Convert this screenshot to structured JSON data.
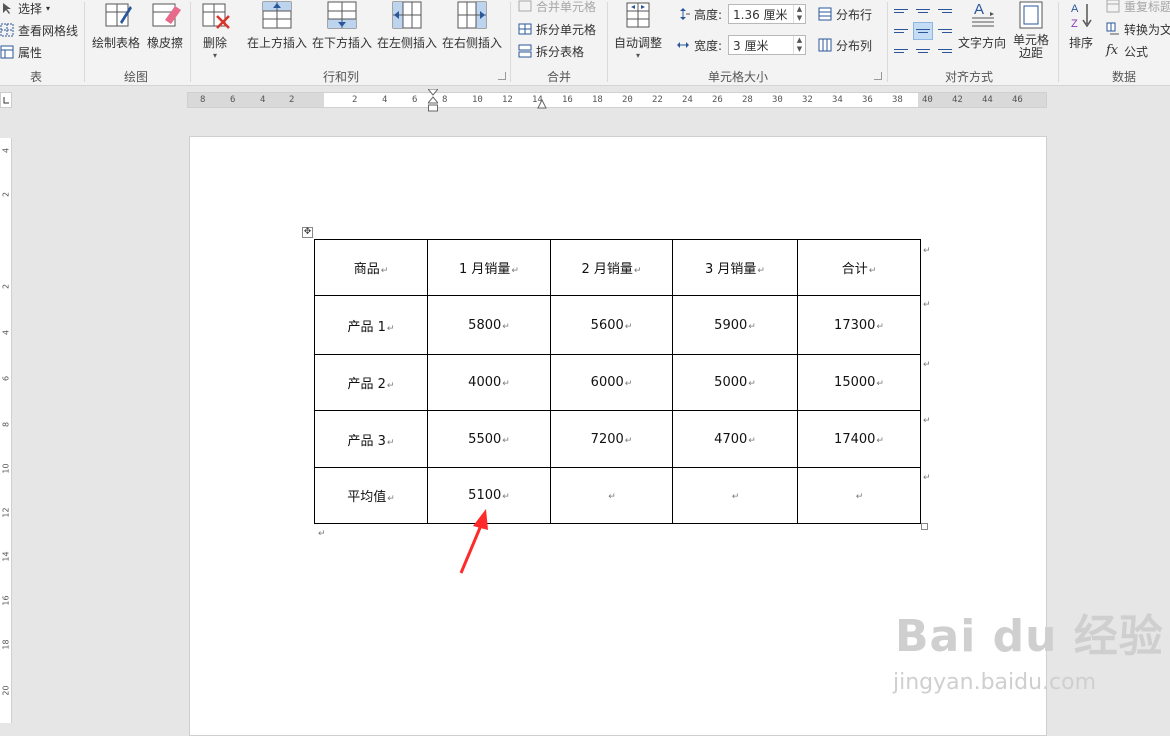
{
  "ribbon": {
    "table_group": {
      "label": "表",
      "select": "选择",
      "view_gridlines": "查看网格线",
      "properties": "属性"
    },
    "draw_group": {
      "label": "绘图",
      "draw_table": "绘制表格",
      "eraser": "橡皮擦"
    },
    "rows_cols_group": {
      "label": "行和列",
      "delete": "删除",
      "insert_above": "在上方插入",
      "insert_below": "在下方插入",
      "insert_left": "在左侧插入",
      "insert_right": "在右侧插入"
    },
    "merge_group": {
      "label": "合并",
      "merge_cells": "合并单元格",
      "split_cells": "拆分单元格",
      "split_table": "拆分表格"
    },
    "cell_size_group": {
      "label": "单元格大小",
      "autofit": "自动调整",
      "height_label": "高度:",
      "height_value": "1.36 厘米",
      "width_label": "宽度:",
      "width_value": "3 厘米",
      "distribute_rows": "分布行",
      "distribute_cols": "分布列"
    },
    "alignment_group": {
      "label": "对齐方式",
      "text_direction": "文字方向",
      "cell_margins_line1": "单元格",
      "cell_margins_line2": "边距"
    },
    "data_group": {
      "label": "数据",
      "sort": "排序",
      "repeat_header": "重复标题",
      "convert_to_text": "转换为文",
      "formula": "公式"
    }
  },
  "ruler": {
    "ticks": [
      "8",
      "6",
      "4",
      "2",
      "2",
      "4",
      "6",
      "8",
      "10",
      "12",
      "14",
      "16",
      "18",
      "20",
      "22",
      "24",
      "26",
      "28",
      "30",
      "32",
      "34",
      "36",
      "38",
      "40",
      "42",
      "44",
      "46"
    ],
    "vticks": [
      "4",
      "2",
      "2",
      "4",
      "6",
      "8",
      "10",
      "12",
      "14",
      "16",
      "18",
      "20"
    ]
  },
  "table": {
    "header": [
      "商品",
      "1 月销量",
      "2 月销量",
      "3 月销量",
      "合计"
    ],
    "rows": [
      [
        "产品 1",
        "5800",
        "5600",
        "5900",
        "17300"
      ],
      [
        "产品 2",
        "4000",
        "6000",
        "5000",
        "15000"
      ],
      [
        "产品 3",
        "5500",
        "7200",
        "4700",
        "17400"
      ],
      [
        "平均值",
        "5100",
        "",
        "",
        ""
      ]
    ]
  },
  "marks": {
    "paragraph_mark": "↵",
    "move_handle": "✥"
  },
  "watermark": {
    "main": "Bai du 经验",
    "sub": "jingyan.baidu.com"
  },
  "colors": {
    "ribbon_bg": "#f3f3f3",
    "accent": "#2b579a",
    "arrow": "#ff2a2a"
  }
}
